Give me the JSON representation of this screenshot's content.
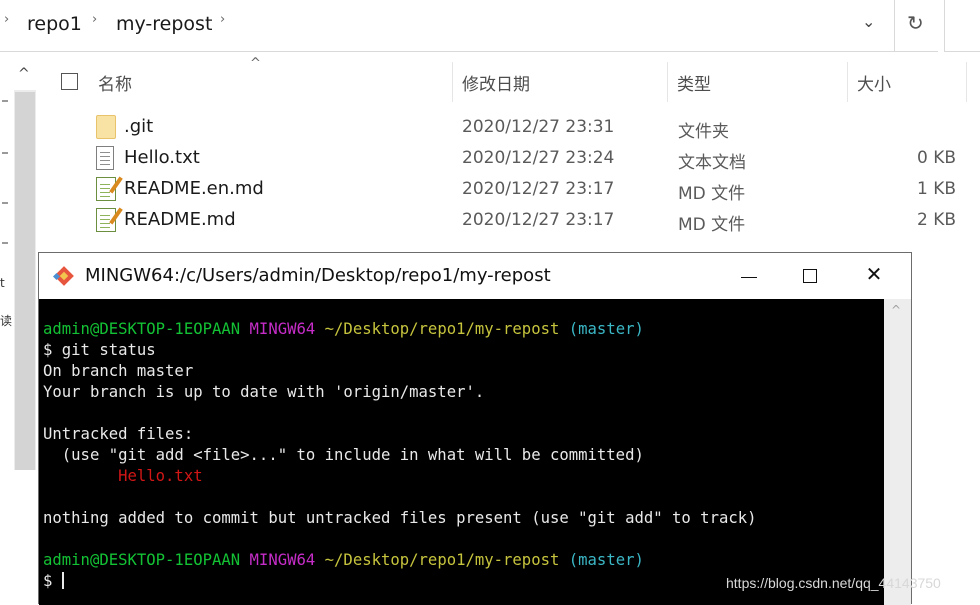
{
  "explorer": {
    "breadcrumb": [
      "repo1",
      "my-repost"
    ],
    "columns": {
      "name": "名称",
      "date": "修改日期",
      "type": "类型",
      "size": "大小"
    },
    "files": [
      {
        "name": ".git",
        "date": "2020/12/27 23:31",
        "type": "文件夹",
        "size": "",
        "icon": "folder-icon"
      },
      {
        "name": "Hello.txt",
        "date": "2020/12/27 23:24",
        "type": "文本文档",
        "size": "0 KB",
        "icon": "text-file-icon"
      },
      {
        "name": "README.en.md",
        "date": "2020/12/27 23:17",
        "type": "MD 文件",
        "size": "1 KB",
        "icon": "markdown-file-icon"
      },
      {
        "name": "README.md",
        "date": "2020/12/27 23:17",
        "type": "MD 文件",
        "size": "2 KB",
        "icon": "markdown-file-icon"
      }
    ],
    "nav_fragments": [
      "t",
      "读"
    ]
  },
  "terminal": {
    "title": "MINGW64:/c/Users/admin/Desktop/repo1/my-repost",
    "controls": {
      "minimize": "—",
      "maximize": "☐",
      "close": "✕"
    },
    "prompt": {
      "user_host": "admin@DESKTOP-1EOPAAN",
      "shell": "MINGW64",
      "path": "~/Desktop/repo1/my-repost",
      "branch": "(master)"
    },
    "command": "$ git status",
    "output": [
      "On branch master",
      "Your branch is up to date with 'origin/master'.",
      "",
      "Untracked files:",
      "  (use \"git add <file>...\" to include in what will be committed)"
    ],
    "untracked_file": "        Hello.txt",
    "summary": "nothing added to commit but untracked files present (use \"git add\" to track)",
    "input_prompt": "$ ",
    "colors": {
      "background": "#000000",
      "text": "#e9e9e9",
      "user_host": "#13c234",
      "shell": "#c62dc8",
      "path": "#c6c43d",
      "branch": "#3bb7c6",
      "untracked": "#d21616"
    }
  },
  "watermark": "https://blog.csdn.net/qq_44143750"
}
